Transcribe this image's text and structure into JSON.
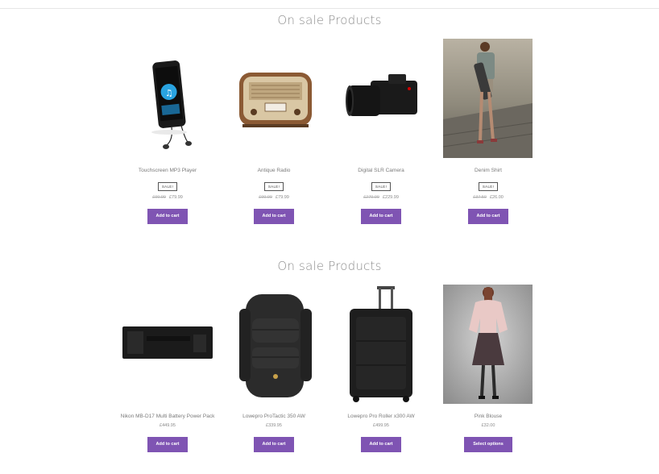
{
  "sections": [
    {
      "title": "On sale Products",
      "products": [
        {
          "name": "Touchscreen MP3 Player",
          "badge": "SALE!",
          "old_price": "£99.99",
          "price": "£79.99",
          "button": "Add to cart",
          "image": "mp3-player-image"
        },
        {
          "name": "Antique Radio",
          "badge": "SALE!",
          "old_price": "£99.99",
          "price": "£79.99",
          "button": "Add to cart",
          "image": "radio-image"
        },
        {
          "name": "Digital SLR Camera",
          "badge": "SALE!",
          "old_price": "£279.99",
          "price": "£229.99",
          "button": "Add to cart",
          "image": "camera-image"
        },
        {
          "name": "Denim Shirt",
          "badge": "SALE!",
          "old_price": "£37.50",
          "price": "£26.00",
          "button": "Add to cart",
          "image": "denim-shirt-photo"
        }
      ]
    },
    {
      "title": "On sale Products",
      "products": [
        {
          "name": "Nikon MB-D17 Multi Battery Power Pack",
          "price": "£449.95",
          "button": "Add to cart",
          "image": "battery-pack-image"
        },
        {
          "name": "Lowepro ProTactic 350 AW",
          "price": "£339.95",
          "button": "Add to cart",
          "image": "backpack-image"
        },
        {
          "name": "Lowepro Pro Roller x300 AW",
          "price": "£499.95",
          "button": "Add to cart",
          "image": "roller-case-image"
        },
        {
          "name": "Pink Blouse",
          "price": "£32.00",
          "button": "Select options",
          "image": "pink-blouse-photo"
        }
      ]
    }
  ],
  "colors": {
    "button": "#7f54b3",
    "text": "#6d6d6d"
  }
}
